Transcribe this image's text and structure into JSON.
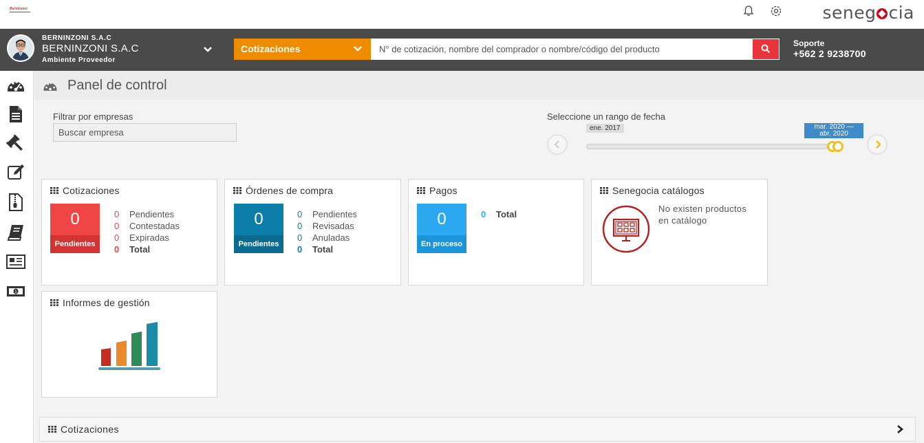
{
  "topbar": {
    "small_logo_text": "Berninzoni",
    "brand_prefix": "seneg",
    "brand_suffix": "cia",
    "icons": [
      "bell-icon",
      "gear-icon"
    ]
  },
  "header": {
    "company_small": "BERNINZONI S.A.C",
    "company_name": "BERNINZONI S.A.C",
    "environment": "Ambiente Proveedor",
    "search_category": "Cotizaciones",
    "search_placeholder": "N° de cotización, nombre del comprador o nombre/código del producto",
    "support_label": "Soporte",
    "support_phone": "+562 2 9238700"
  },
  "sidebar": {
    "items": [
      "dashboard-icon",
      "document-icon",
      "gavel-icon",
      "edit-icon",
      "zip-file-icon",
      "book-icon",
      "newspaper-icon",
      "money-icon"
    ]
  },
  "page": {
    "title": "Panel de control"
  },
  "filters": {
    "company_label": "Filtrar por empresas",
    "company_placeholder": "Buscar empresa",
    "range_label": "Seleccione un rango de fecha",
    "range_start": "ene. 2017",
    "range_end_1": "mar. 2020 —",
    "range_end_2": "abr. 2020"
  },
  "cards": {
    "cotizaciones": {
      "title": "Cotizaciones",
      "big_value": "0",
      "big_label": "Pendientes",
      "stats": [
        {
          "value": "0",
          "label": "Pendientes"
        },
        {
          "value": "0",
          "label": "Contestadas"
        },
        {
          "value": "0",
          "label": "Expiradas"
        },
        {
          "value": "0",
          "label": "Total"
        }
      ]
    },
    "ordenes": {
      "title": "Órdenes de compra",
      "big_value": "0",
      "big_label": "Pendientes",
      "stats": [
        {
          "value": "0",
          "label": "Pendientes"
        },
        {
          "value": "0",
          "label": "Revisadas"
        },
        {
          "value": "0",
          "label": "Anuladas"
        },
        {
          "value": "0",
          "label": "Total"
        }
      ]
    },
    "pagos": {
      "title": "Pagos",
      "big_value": "0",
      "big_label": "En proceso",
      "stats": [
        {
          "value": "0",
          "label": "Total"
        }
      ]
    },
    "catalogos": {
      "title": "Senegocia catálogos",
      "message_line1": "No existen productos",
      "message_line2": "en catálogo"
    },
    "informes": {
      "title": "Informes de gestión"
    }
  },
  "bottom": {
    "label": "Cotizaciones"
  },
  "colors": {
    "accent_orange": "#ee8c00",
    "search_red": "#e8343a",
    "cot_red": "#f04545",
    "ord_teal": "#0a7ea8",
    "pagos_blue": "#2aa9f0",
    "brand_red": "#d0021b"
  }
}
